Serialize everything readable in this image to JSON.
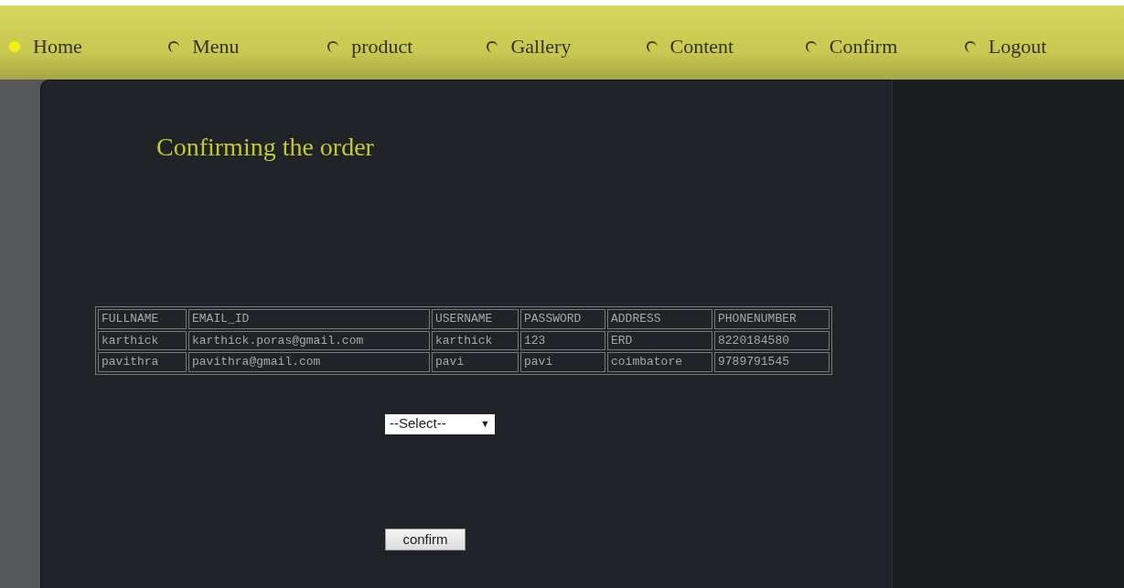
{
  "nav": [
    {
      "label": "Home",
      "selected": true
    },
    {
      "label": "Menu",
      "selected": false
    },
    {
      "label": "product",
      "selected": false
    },
    {
      "label": "Gallery",
      "selected": false
    },
    {
      "label": "Content",
      "selected": false
    },
    {
      "label": "Confirm",
      "selected": false
    },
    {
      "label": "Logout",
      "selected": false
    }
  ],
  "title": "Confirming the order",
  "table": {
    "columns": [
      "FULLNAME",
      "EMAIL_ID",
      "USERNAME",
      "PASSWORD",
      "ADDRESS",
      "PHONENUMBER"
    ],
    "rows": [
      [
        "karthick",
        "karthick.poras@gmail.com",
        "karthick",
        "123",
        "ERD",
        "8220184580"
      ],
      [
        "pavithra",
        "pavithra@gmail.com",
        "pavi",
        "pavi",
        "coimbatore",
        "9789791545"
      ]
    ]
  },
  "select": {
    "value": "--Select--",
    "arrow": "▼"
  },
  "button": "confirm"
}
